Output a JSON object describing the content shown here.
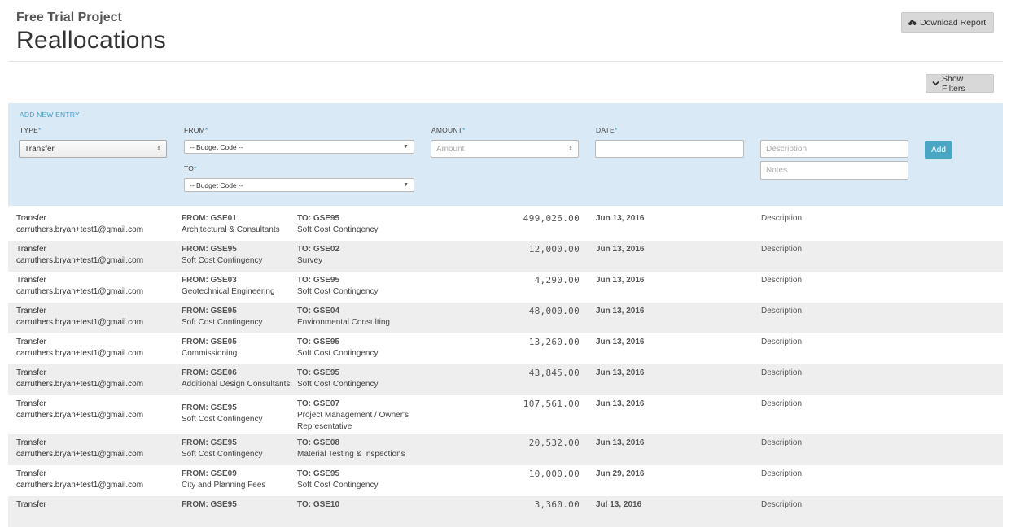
{
  "header": {
    "project": "Free Trial Project",
    "title": "Reallocations"
  },
  "buttons": {
    "download": "Download Report",
    "filters": "Show Filters"
  },
  "icons": {
    "download": "cloud-download-icon",
    "filters": "chevron-down-icon"
  },
  "form": {
    "add_new": "ADD NEW ENTRY",
    "type_label": "TYPE",
    "from_label": "FROM",
    "to_label": "TO",
    "amount_label": "AMOUNT",
    "date_label": "DATE",
    "req": "*",
    "type_value": "Transfer",
    "from_value": "-- Budget Code --",
    "to_value": "-- Budget Code --",
    "amount_placeholder": "Amount",
    "date_value": "",
    "description_placeholder": "Description",
    "notes_placeholder": "Notes",
    "add_button": "Add"
  },
  "accent_color": "#4aa7c4",
  "rows": [
    {
      "type": "Transfer",
      "user": "carruthers.bryan+test1@gmail.com",
      "from_code": "FROM: GSE01",
      "from_name": "Architectural & Consultants",
      "to_code": "TO: GSE95",
      "to_name": "Soft Cost Contingency",
      "amount": "499,026.00",
      "date": "Jun 13, 2016",
      "desc": "Description"
    },
    {
      "type": "Transfer",
      "user": "carruthers.bryan+test1@gmail.com",
      "from_code": "FROM: GSE95",
      "from_name": "Soft Cost Contingency",
      "to_code": "TO: GSE02",
      "to_name": "Survey",
      "amount": "12,000.00",
      "date": "Jun 13, 2016",
      "desc": "Description"
    },
    {
      "type": "Transfer",
      "user": "carruthers.bryan+test1@gmail.com",
      "from_code": "FROM: GSE03",
      "from_name": "Geotechnical Engineering",
      "to_code": "TO: GSE95",
      "to_name": "Soft Cost Contingency",
      "amount": "4,290.00",
      "date": "Jun 13, 2016",
      "desc": "Description"
    },
    {
      "type": "Transfer",
      "user": "carruthers.bryan+test1@gmail.com",
      "from_code": "FROM: GSE95",
      "from_name": "Soft Cost Contingency",
      "to_code": "TO: GSE04",
      "to_name": "Environmental Consulting",
      "amount": "48,000.00",
      "date": "Jun 13, 2016",
      "desc": "Description"
    },
    {
      "type": "Transfer",
      "user": "carruthers.bryan+test1@gmail.com",
      "from_code": "FROM: GSE05",
      "from_name": "Commissioning",
      "to_code": "TO: GSE95",
      "to_name": "Soft Cost Contingency",
      "amount": "13,260.00",
      "date": "Jun 13, 2016",
      "desc": "Description"
    },
    {
      "type": "Transfer",
      "user": "carruthers.bryan+test1@gmail.com",
      "from_code": "FROM: GSE06",
      "from_name": "Additional Design Consultants",
      "to_code": "TO: GSE95",
      "to_name": "Soft Cost Contingency",
      "amount": "43,845.00",
      "date": "Jun 13, 2016",
      "desc": "Description"
    },
    {
      "type": "Transfer",
      "user": "carruthers.bryan+test1@gmail.com",
      "from_code": "FROM: GSE95",
      "from_name": "Soft Cost Contingency",
      "to_code": "TO: GSE07",
      "to_name": "Project Management / Owner's Representative",
      "amount": "107,561.00",
      "date": "Jun 13, 2016",
      "desc": "Description"
    },
    {
      "type": "Transfer",
      "user": "carruthers.bryan+test1@gmail.com",
      "from_code": "FROM: GSE95",
      "from_name": "Soft Cost Contingency",
      "to_code": "TO: GSE08",
      "to_name": "Material Testing & Inspections",
      "amount": "20,532.00",
      "date": "Jun 13, 2016",
      "desc": "Description"
    },
    {
      "type": "Transfer",
      "user": "carruthers.bryan+test1@gmail.com",
      "from_code": "FROM: GSE09",
      "from_name": "City and Planning Fees",
      "to_code": "TO: GSE95",
      "to_name": "Soft Cost Contingency",
      "amount": "10,000.00",
      "date": "Jun 29, 2016",
      "desc": "Description"
    },
    {
      "type": "Transfer",
      "user": "",
      "from_code": "FROM: GSE95",
      "from_name": "",
      "to_code": "TO: GSE10",
      "to_name": "",
      "amount": "3,360.00",
      "date": "Jul 13, 2016",
      "desc": "Description"
    }
  ]
}
